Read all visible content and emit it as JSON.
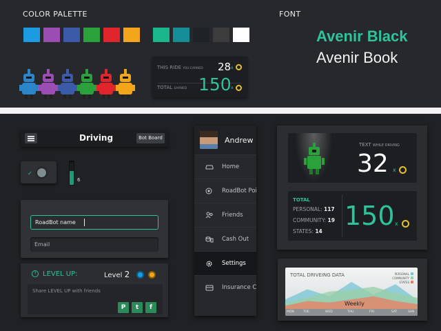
{
  "palette": {
    "heading": "COLOR PALETTE",
    "row1": [
      "#1b9ce2",
      "#9b4db3",
      "#3b5ba8",
      "#2aa13a",
      "#e0262c",
      "#f4a61b"
    ],
    "row2": [
      "#1bb68c",
      "#168e98",
      "#1f2328",
      "#3c3c3c",
      "#ffffff"
    ],
    "robot_colors": [
      "#2a86c8",
      "#9b4db3",
      "#3b5ba8",
      "#2aa13a",
      "#e0262c",
      "#f4a61b"
    ]
  },
  "font": {
    "heading": "FONT",
    "sample_bold": "Avenir Black",
    "sample_book": "Avenir Book"
  },
  "ride_card": {
    "this_ride_label": "THIS RIDE",
    "this_ride_sub": "YOU EARNED",
    "this_ride_value": "28",
    "total_label": "TOTAL",
    "total_sub": "EARNED",
    "total_value": "150",
    "multiplier": "x"
  },
  "driving_bar": {
    "title": "Driving",
    "bot_board_label": "Bot Board"
  },
  "toggle": {
    "state": "on"
  },
  "slider": {
    "value_text": "6",
    "level": 0.6
  },
  "form": {
    "name_value": "RoadBot name",
    "email_placeholder": "Email"
  },
  "level_card": {
    "title": "LEVEL UP:",
    "level_label": "Level",
    "level_value": "2",
    "share_placeholder": "Share LEVEL UP with friends",
    "social": [
      "P",
      "t",
      "f"
    ]
  },
  "nav": {
    "user_name": "Andrew",
    "items": [
      {
        "label": "Home",
        "icon": "car-icon"
      },
      {
        "label": "RoadBot Poi",
        "icon": "badge-icon"
      },
      {
        "label": "Friends",
        "icon": "friends-icon"
      },
      {
        "label": "Cash Out",
        "icon": "coins-icon"
      },
      {
        "label": "Settings",
        "icon": "gear-icon"
      },
      {
        "label": "Insurance Co",
        "icon": "card-icon"
      }
    ],
    "active_index": 4
  },
  "driving_card": {
    "caption": "TEXT",
    "caption_sub": "WHILE DRIVING",
    "value": "32",
    "multiplier": "x"
  },
  "total_card": {
    "title": "TOTAL",
    "personal_label": "PERSONAL:",
    "personal_value": "117",
    "community_label": "COMMUNITY:",
    "community_value": "19",
    "states_label": "STATES:",
    "states_value": "14",
    "value": "150",
    "multiplier": "x"
  },
  "chart_data": {
    "type": "area",
    "title": "TOTAL DRIVEING DATA",
    "center_label": "Weekly",
    "categories": [
      "MON",
      "TUE",
      "WED",
      "THU",
      "FRI",
      "SAT",
      "SUN"
    ],
    "legend": [
      "PERSONAL",
      "COMMUNITY",
      "STATES"
    ],
    "legend_colors": [
      "#7ac6d6",
      "#9ad0a8",
      "#e98065"
    ],
    "series": [
      {
        "values": [
          30,
          62,
          40,
          85,
          45,
          78,
          28
        ]
      },
      {
        "values": [
          20,
          35,
          55,
          60,
          70,
          50,
          35
        ]
      },
      {
        "values": [
          10,
          25,
          20,
          30,
          40,
          25,
          15
        ]
      }
    ],
    "ylim": [
      0,
      100
    ]
  }
}
